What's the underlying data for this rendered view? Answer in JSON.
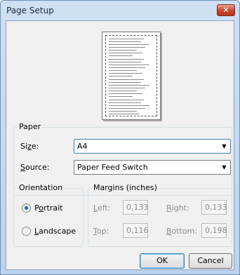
{
  "window": {
    "title": "Page Setup",
    "close_glyph": "✕"
  },
  "paper": {
    "group_label": "Paper",
    "size_label_a": "Si",
    "size_label_u": "z",
    "size_label_b": "e:",
    "size_value": "A4",
    "source_label_u": "S",
    "source_label_b": "ource:",
    "source_value": "Paper Feed Switch"
  },
  "orientation": {
    "group_label": "Orientation",
    "portrait_a": "P",
    "portrait_u": "o",
    "portrait_b": "rtrait",
    "landscape_u": "L",
    "landscape_b": "andscape",
    "selected": "Portrait"
  },
  "margins": {
    "group_label": "Margins (inches)",
    "left_label_u": "L",
    "left_label_b": "eft:",
    "left_value": "0,133",
    "right_label_u": "R",
    "right_label_b": "ight:",
    "right_value": "0,133",
    "top_label_u": "T",
    "top_label_b": "op:",
    "top_value": "0,116",
    "bottom_label_u": "B",
    "bottom_label_b": "ottom:",
    "bottom_value": "0,198"
  },
  "buttons": {
    "ok": "OK",
    "cancel": "Cancel"
  },
  "icons": {
    "close": "close-icon",
    "combo_arrow": "chevron-down-icon"
  }
}
